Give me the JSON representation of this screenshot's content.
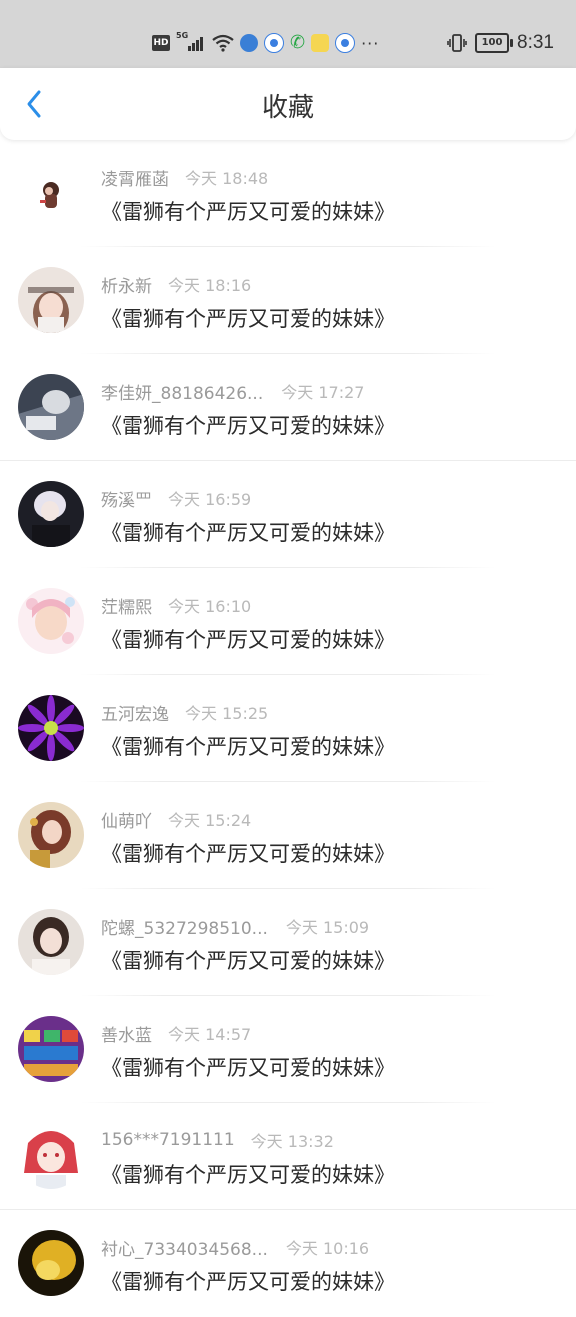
{
  "status_bar": {
    "hd": "HD",
    "network": "5G",
    "battery": "100",
    "time": "8:31",
    "icons": [
      "hd-badge-icon",
      "signal-icon",
      "wifi-icon",
      "browser-app-icon",
      "paw-app-icon",
      "phone-icon",
      "chat-app-icon",
      "paw-app-icon",
      "more-icon",
      "vibrate-icon",
      "battery-icon"
    ]
  },
  "header": {
    "back_icon": "chevron-left-icon",
    "title": "收藏"
  },
  "colors": {
    "accent": "#2b8ee8",
    "title_text": "#333333",
    "username_text": "#9a9a9a",
    "timestamp_text": "#b9b9b9",
    "item_text": "#2a2a2a",
    "status_bar_bg": "#d6d6d6"
  },
  "favorites": [
    {
      "username": "凌霄雁菡",
      "time": "今天 18:48",
      "title": "《雷狮有个严厉又可爱的妹妹》"
    },
    {
      "username": "析永新",
      "time": "今天 18:16",
      "title": "《雷狮有个严厉又可爱的妹妹》"
    },
    {
      "username": "李佳妍_88186426...",
      "time": "今天 17:27",
      "title": "《雷狮有个严厉又可爱的妹妹》"
    },
    {
      "username": "殇溪罒",
      "time": "今天 16:59",
      "title": "《雷狮有个严厉又可爱的妹妹》"
    },
    {
      "username": "茳糯熙",
      "time": "今天 16:10",
      "title": "《雷狮有个严厉又可爱的妹妹》"
    },
    {
      "username": "五河宏逸",
      "time": "今天 15:25",
      "title": "《雷狮有个严厉又可爱的妹妹》"
    },
    {
      "username": "仙萌吖",
      "time": "今天 15:24",
      "title": "《雷狮有个严厉又可爱的妹妹》"
    },
    {
      "username": "陀螺_5327298510...",
      "time": "今天 15:09",
      "title": "《雷狮有个严厉又可爱的妹妹》"
    },
    {
      "username": "善水蓝",
      "time": "今天 14:57",
      "title": "《雷狮有个严厉又可爱的妹妹》"
    },
    {
      "username": "156***7191111",
      "time": "今天 13:32",
      "title": "《雷狮有个严厉又可爱的妹妹》"
    },
    {
      "username": "衬心_7334034568...",
      "time": "今天 10:16",
      "title": "《雷狮有个严厉又可爱的妹妹》"
    }
  ]
}
